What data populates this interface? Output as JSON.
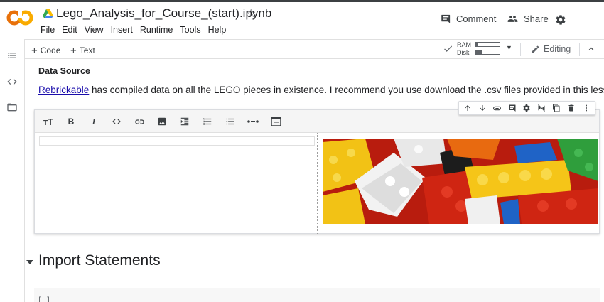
{
  "header": {
    "logo_text": "CO",
    "notebook_title": "Lego_Analysis_for_Course_(start).ipynb",
    "menu": [
      "File",
      "Edit",
      "View",
      "Insert",
      "Runtime",
      "Tools",
      "Help"
    ],
    "comment_label": "Comment",
    "share_label": "Share",
    "icons": [
      "colab-logo",
      "drive-icon",
      "star-icon",
      "comment-icon",
      "share-icon",
      "gear-icon"
    ]
  },
  "toolbar": {
    "add_code": "Code",
    "add_text": "Text",
    "ram_label": "RAM",
    "disk_label": "Disk",
    "ram_fill": 0.1,
    "disk_fill": 0.25,
    "editing_label": "Editing"
  },
  "sidebar": {
    "icons": [
      "toc-icon",
      "code-snippets-icon",
      "files-icon"
    ]
  },
  "content": {
    "heading": "Data Source",
    "link_text": "Rebrickable",
    "para_rest": " has compiled data on all the LEGO pieces in existence. I recommend you use download the .csv files provided in this lesson.",
    "cell_toolbar_icons": [
      "move-up-icon",
      "move-down-icon",
      "link-icon",
      "comment-icon",
      "settings-icon",
      "mirror-cell-icon",
      "copy-icon",
      "delete-icon",
      "more-icon"
    ],
    "format_icons": [
      "heading-icon",
      "bold-icon",
      "italic-icon",
      "code-icon",
      "link-icon",
      "image-icon",
      "indent-icon",
      "numbered-list-icon",
      "bullet-list-icon",
      "horizontal-rule-icon",
      "preview-mode-icon"
    ],
    "section_title": "Import Statements",
    "run_bracket": "[ ]"
  },
  "colors": {
    "colab_orange": "#F9AB00",
    "colab_yellow": "#E8710A",
    "link": "#1a0dab"
  }
}
